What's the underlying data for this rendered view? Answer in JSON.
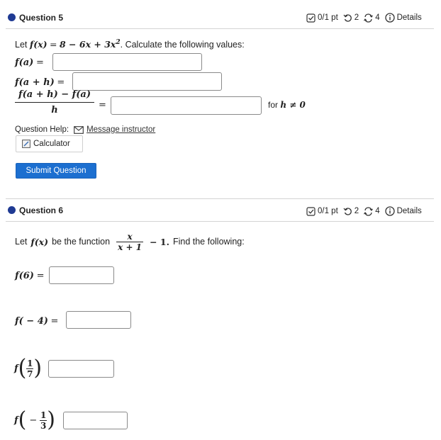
{
  "q5": {
    "title": "Question 5",
    "score": "0/1 pt",
    "retries": "2",
    "submissions": "4",
    "details": "Details",
    "prompt_before": "Let",
    "fx": "f(x)",
    "eq": "=",
    "expr": "8 − 6x + 3x",
    "exp": "2",
    "prompt_after": ". Calculate the following values:",
    "fa_label": "f(a)",
    "fah_label": "f(a + h)",
    "dq_num": "f(a + h) − f(a)",
    "dq_den": "h",
    "for_h": "for",
    "h_cond": "h ≠ 0",
    "help_label": "Question Help:",
    "message_link": "Message instructor",
    "calculator_label": "Calculator",
    "submit_label": "Submit Question"
  },
  "q6": {
    "title": "Question 6",
    "score": "0/1 pt",
    "retries": "2",
    "submissions": "4",
    "details": "Details",
    "prompt_before": "Let",
    "fx": "f(x)",
    "prompt_mid": "be the function",
    "frac_num": "x",
    "frac_den": "x + 1",
    "minus_one": "− 1.",
    "prompt_after": "Find the following:",
    "f6_label": "f(6)",
    "fm4_label": "f( − 4)",
    "f": "f",
    "third_num": "1",
    "third_den": "7",
    "fourth_sign": "−",
    "fourth_num": "1",
    "fourth_den": "3"
  },
  "colors": {
    "accent": "#1f3a93",
    "submit": "#1c6fd0"
  }
}
